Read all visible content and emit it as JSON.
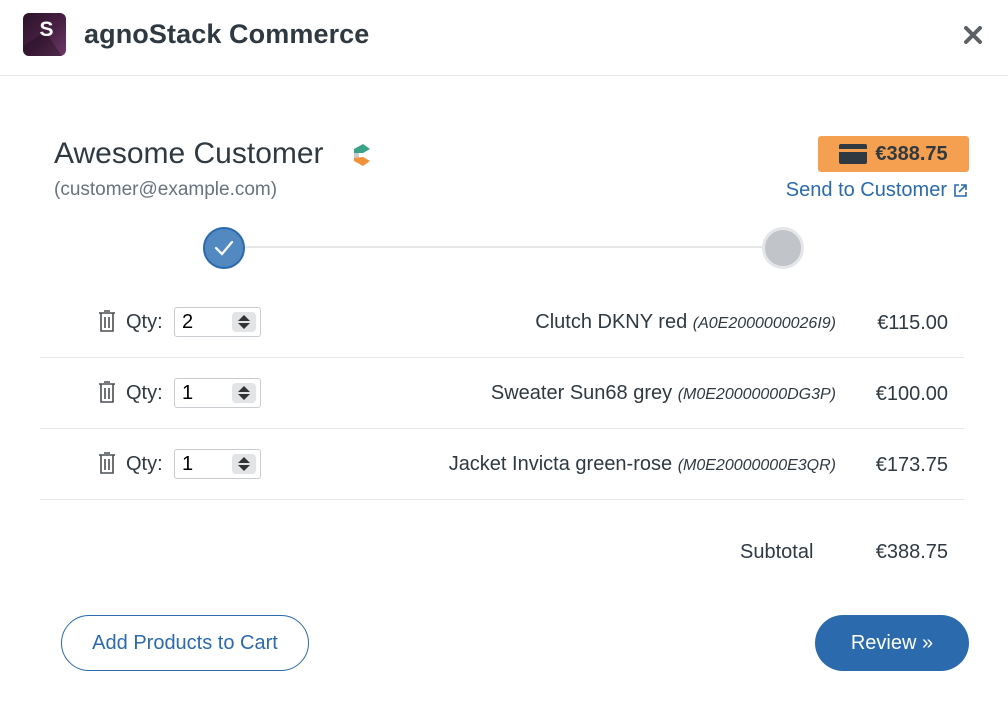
{
  "header": {
    "app_logo_letter": "S",
    "app_title": "agnoStack Commerce",
    "close_icon": "close-icon"
  },
  "customer": {
    "name": "Awesome Customer",
    "email": "(customer@example.com)",
    "crm_icon": "layered-cube-icon"
  },
  "order": {
    "total_badge": "€388.75",
    "badge_icon": "credit-card-icon",
    "badge_color": "#f5a050",
    "send_link": "Send to Customer",
    "send_link_icon": "external-link-icon"
  },
  "stepper": {
    "steps": [
      {
        "state": "complete",
        "icon": "checkmark-icon"
      },
      {
        "state": "pending"
      }
    ]
  },
  "cart": {
    "qty_label": "Qty:",
    "items": [
      {
        "qty": "2",
        "name": "Clutch DKNY red",
        "sku": "(A0E2000000026I9)",
        "price": "€115.00"
      },
      {
        "qty": "1",
        "name": "Sweater Sun68 grey",
        "sku": "(M0E20000000DG3P)",
        "price": "€100.00"
      },
      {
        "qty": "1",
        "name": "Jacket Invicta green-rose",
        "sku": "(M0E20000000E3QR)",
        "price": "€173.75"
      }
    ],
    "subtotal_label": "Subtotal",
    "subtotal_value": "€388.75"
  },
  "actions": {
    "add_products": "Add Products to Cart",
    "review": "Review »"
  },
  "colors": {
    "primary": "#2a6aad",
    "text": "#2f3941",
    "muted": "#68737d",
    "accent_orange": "#f5a050"
  }
}
